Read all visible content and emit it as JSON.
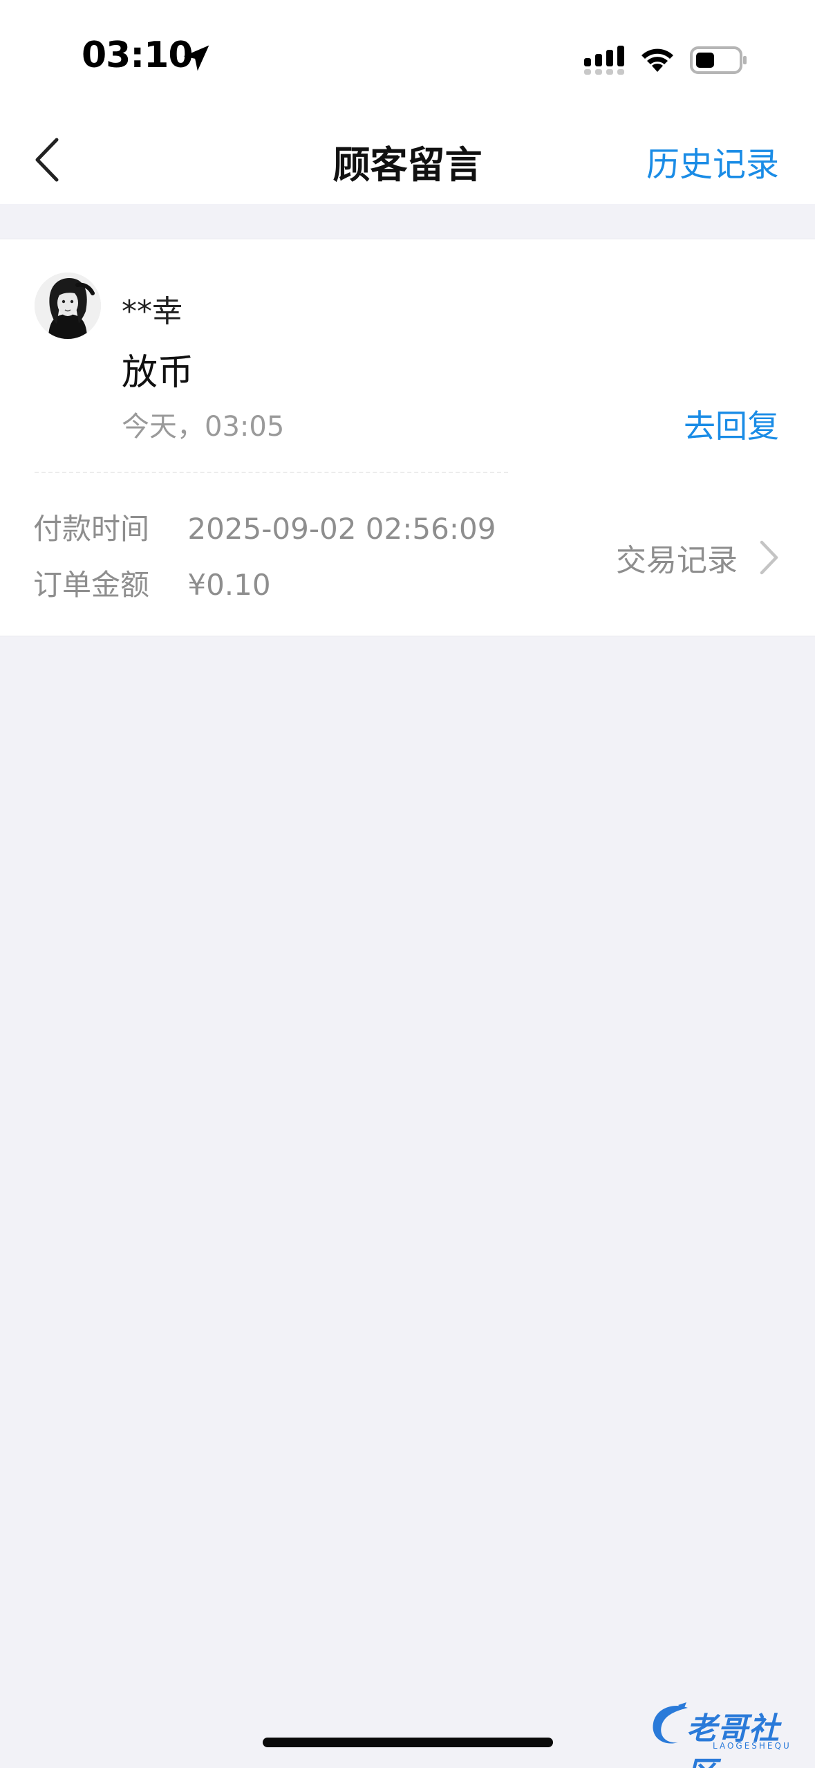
{
  "status_bar": {
    "time": "03:10"
  },
  "nav": {
    "title": "顾客留言",
    "history_label": "历史记录"
  },
  "message": {
    "username": "**幸",
    "text": "放币",
    "time": "今天，03:05",
    "reply_label": "去回复"
  },
  "order": {
    "pay_time_label": "付款时间",
    "pay_time_value": "2025-09-02 02:56:09",
    "amount_label": "订单金额",
    "amount_value": "¥0.10",
    "trade_record_label": "交易记录"
  },
  "watermark": {
    "text": "老哥社区",
    "sub": "LAOGESHEQU"
  },
  "colors": {
    "accent": "#1a8ce6",
    "background": "#f2f2f7",
    "muted": "#8e8e8e"
  }
}
